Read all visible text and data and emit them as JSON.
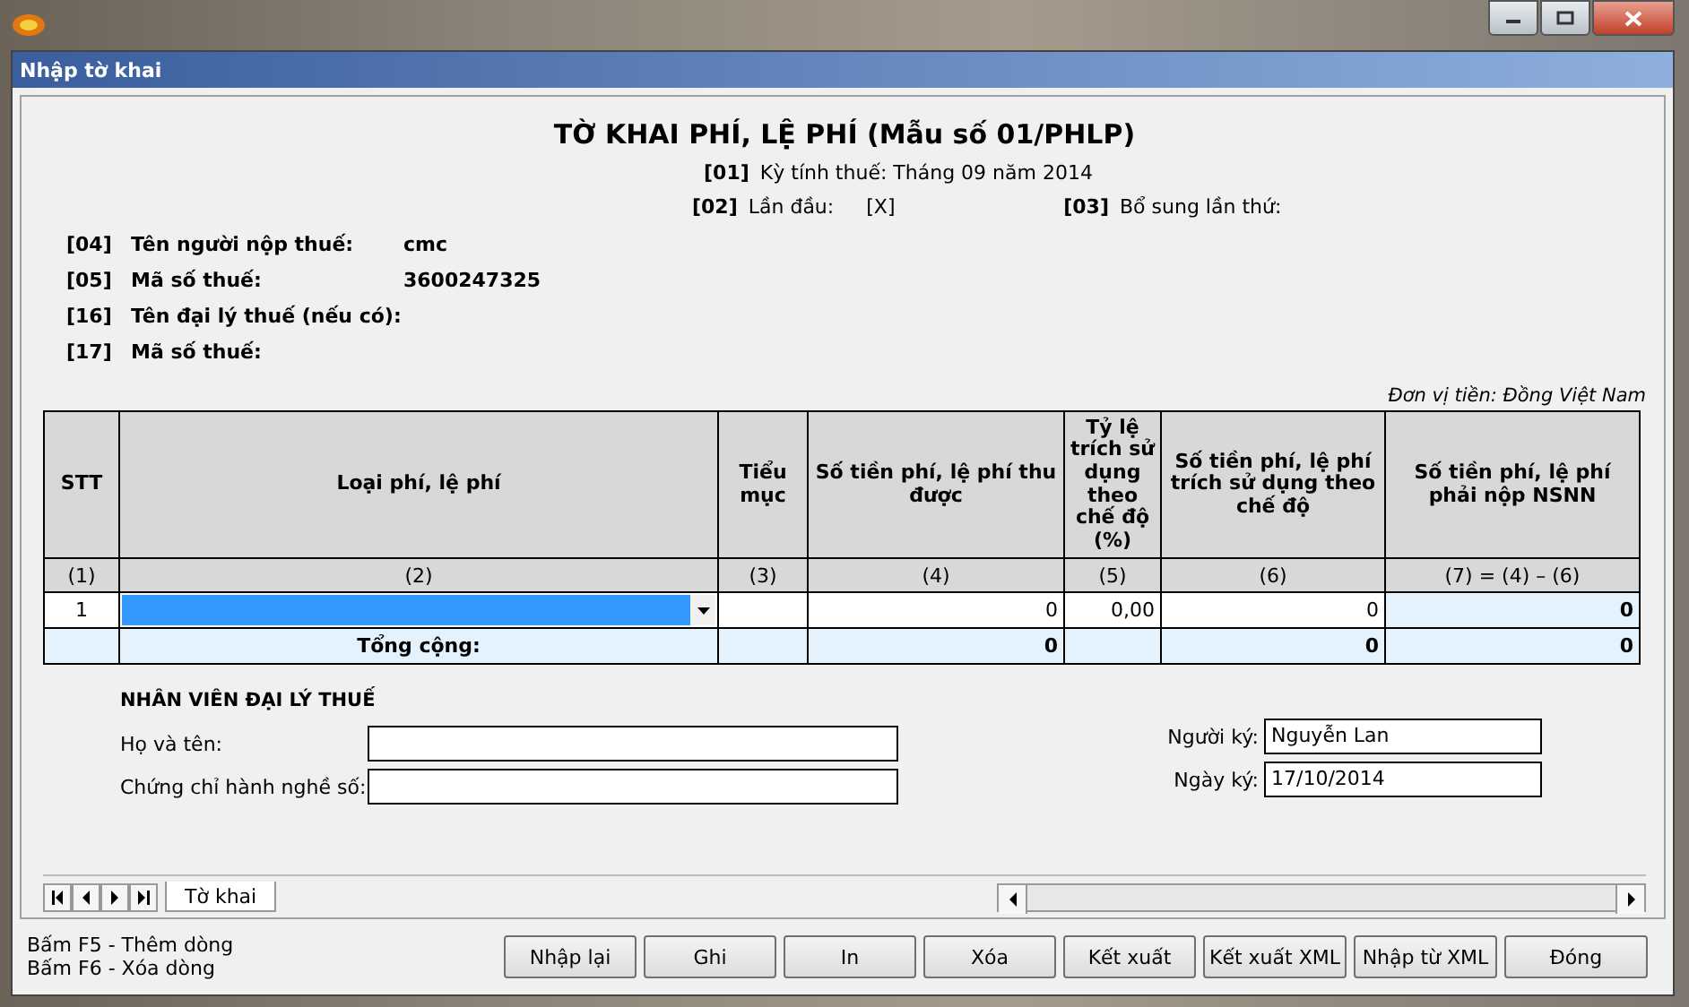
{
  "window": {
    "dialog_title": "Nhập tờ khai"
  },
  "form": {
    "title": "TỜ KHAI PHÍ, LỆ PHÍ (Mẫu số 01/PHLP)",
    "period": {
      "code": "[01]",
      "label": "Kỳ tính thuế: Tháng 09 năm 2014"
    },
    "first_time": {
      "code": "[02]",
      "label": "Lần đầu:",
      "value": "[X]"
    },
    "supplement": {
      "code": "[03]",
      "label": "Bổ sung lần thứ:"
    },
    "taxpayer_fields": [
      {
        "code": "[04]",
        "label": "Tên người nộp thuế:",
        "value": "cmc"
      },
      {
        "code": "[05]",
        "label": "Mã số thuế:",
        "value": "3600247325"
      },
      {
        "code": "[16]",
        "label": "Tên đại lý thuế (nếu có):"
      },
      {
        "code": "[17]",
        "label": "Mã số thuế:"
      }
    ],
    "currency_note": "Đơn vị tiền:  Đồng Việt Nam"
  },
  "table": {
    "columns": [
      {
        "header": "STT",
        "number": "(1)"
      },
      {
        "header": "Loại phí, lệ phí",
        "number": "(2)"
      },
      {
        "header": "Tiểu mục",
        "number": "(3)"
      },
      {
        "header": "Số tiền phí, lệ phí  thu được",
        "number": "(4)"
      },
      {
        "header": "Tỷ lệ trích sử dụng theo chế độ (%)",
        "number": "(5)"
      },
      {
        "header": "Số tiền phí, lệ phí trích sử dụng theo chế độ",
        "number": "(6)"
      },
      {
        "header": "Số tiền phí, lệ phí phải nộp NSNN",
        "number": "(7) = (4) – (6)"
      }
    ],
    "rows": [
      {
        "cells": [
          {
            "kind": "index",
            "value": "1"
          },
          {
            "kind": "dropdown",
            "focused": true
          },
          {
            "kind": "input"
          },
          {
            "kind": "input",
            "value": "0"
          },
          {
            "kind": "input",
            "value": "0,00"
          },
          {
            "kind": "input",
            "value": "0"
          },
          {
            "kind": "computed",
            "value": "0"
          }
        ]
      },
      {
        "cells": [
          {
            "kind": "computed"
          },
          {
            "kind": "label",
            "value": "Tổng cộng:"
          },
          {
            "kind": "computed"
          },
          {
            "kind": "computed",
            "value": "0"
          },
          {
            "kind": "computed"
          },
          {
            "kind": "computed",
            "value": "0"
          },
          {
            "kind": "computed",
            "value": "0"
          }
        ]
      }
    ]
  },
  "agent": {
    "heading": "NHÂN VIÊN ĐẠI LÝ THUẾ",
    "fields": [
      {
        "label": "Họ và tên:"
      },
      {
        "label": "Chứng chỉ hành nghề số:"
      }
    ],
    "signer_fields": [
      {
        "label": "Người ký:",
        "value": "Nguyễn Lan"
      },
      {
        "label": "Ngày ký:",
        "value": "17/10/2014"
      }
    ]
  },
  "sheet_tabs": [
    {
      "label": "Tờ khai",
      "selected": true
    }
  ],
  "hints": [
    "Bấm F5 - Thêm dòng",
    "Bấm F6 - Xóa dòng"
  ],
  "buttons": [
    "Nhập lại",
    "Ghi",
    "In",
    "Xóa",
    "Kết xuất",
    "Kết xuất XML",
    "Nhập từ XML",
    "Đóng"
  ]
}
